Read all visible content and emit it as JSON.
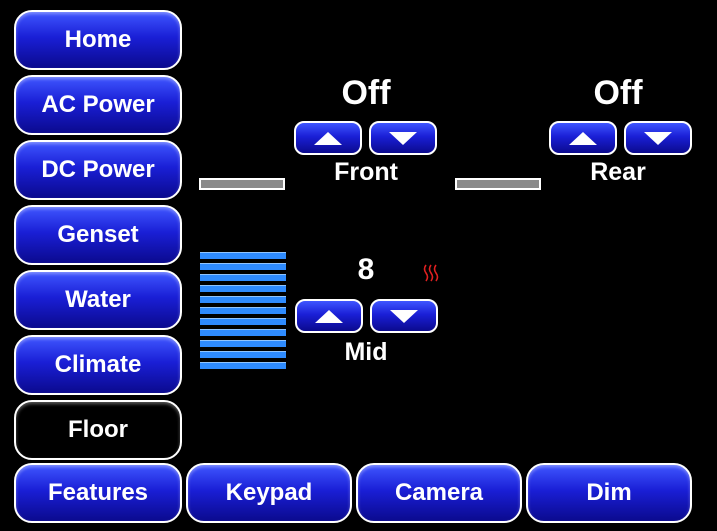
{
  "nav": {
    "items": [
      {
        "label": "Home"
      },
      {
        "label": "AC Power"
      },
      {
        "label": "DC Power"
      },
      {
        "label": "Genset"
      },
      {
        "label": "Water"
      },
      {
        "label": "Climate"
      },
      {
        "label": "Floor",
        "active": true
      },
      {
        "label": "Features"
      }
    ]
  },
  "bottom_bar": {
    "keypad": "Keypad",
    "camera": "Camera",
    "dim": "Dim"
  },
  "zones": {
    "front": {
      "label": "Front",
      "status": "Off"
    },
    "rear": {
      "label": "Rear",
      "status": "Off"
    },
    "mid": {
      "label": "Mid",
      "level": "8",
      "heat_icon": "heat-waves-icon"
    }
  },
  "colors": {
    "button_blue": "#1a1fd6",
    "level_blue": "#2e8bff",
    "heat_red": "#e02020"
  }
}
